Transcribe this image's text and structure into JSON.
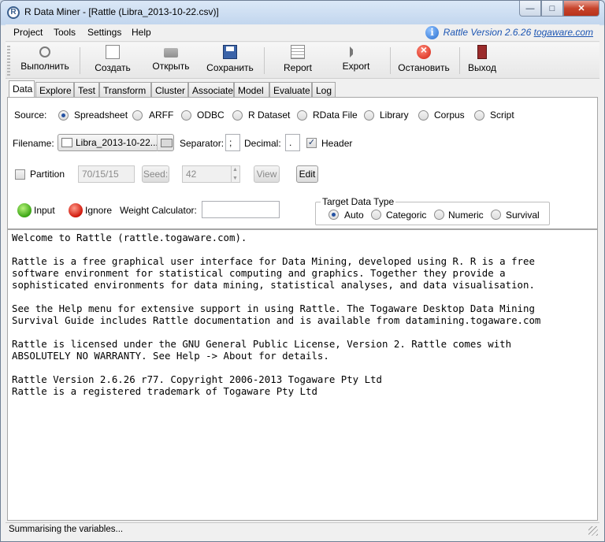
{
  "window": {
    "title": "R Data Miner - [Rattle (Libra_2013-10-22.csv)]",
    "app_icon_glyph": "R",
    "min_glyph": "—",
    "max_glyph": "□",
    "close_glyph": "✕"
  },
  "menubar": {
    "items": [
      "Project",
      "Tools",
      "Settings",
      "Help"
    ],
    "version_prefix": "Rattle Version 2.6.26 ",
    "version_link": "togaware.com",
    "info_glyph": "i"
  },
  "toolbar": {
    "buttons": [
      {
        "label": "Выполнить",
        "icon": "gear-icon"
      },
      {
        "label": "Создать",
        "icon": "new-document-icon"
      },
      {
        "label": "Открыть",
        "icon": "open-folder-icon"
      },
      {
        "label": "Сохранить",
        "icon": "save-icon"
      },
      {
        "label": "Report",
        "icon": "report-icon"
      },
      {
        "label": "Export",
        "icon": "export-icon"
      },
      {
        "label": "Остановить",
        "icon": "stop-icon"
      },
      {
        "label": "Выход",
        "icon": "exit-icon"
      }
    ]
  },
  "tabs": [
    "Data",
    "Explore",
    "Test",
    "Transform",
    "Cluster",
    "Associate",
    "Model",
    "Evaluate",
    "Log"
  ],
  "data_tab": {
    "source_label": "Source:",
    "sources": [
      {
        "label": "Spreadsheet",
        "selected": true
      },
      {
        "label": "ARFF",
        "selected": false
      },
      {
        "label": "ODBC",
        "selected": false
      },
      {
        "label": "R Dataset",
        "selected": false
      },
      {
        "label": "RData File",
        "selected": false
      },
      {
        "label": "Library",
        "selected": false
      },
      {
        "label": "Corpus",
        "selected": false
      },
      {
        "label": "Script",
        "selected": false
      }
    ],
    "filename_label": "Filename:",
    "filename_value": "Libra_2013-10-22...",
    "separator_label": "Separator:",
    "separator_value": ";",
    "decimal_label": "Decimal:",
    "decimal_value": ".",
    "header_label": "Header",
    "header_checked": true,
    "check_glyph": "✓",
    "partition_label": "Partition",
    "partition_checked": false,
    "partition_value": "70/15/15",
    "seed_label": "Seed:",
    "seed_value": "42",
    "view_label": "View",
    "edit_label": "Edit",
    "input_label": "Input",
    "ignore_label": "Ignore",
    "weight_label": "Weight Calculator:",
    "weight_value": "",
    "target_type_title": "Target Data Type",
    "target_types": [
      {
        "label": "Auto",
        "selected": true
      },
      {
        "label": "Categoric",
        "selected": false
      },
      {
        "label": "Numeric",
        "selected": false
      },
      {
        "label": "Survival",
        "selected": false
      }
    ]
  },
  "textview": {
    "lines": [
      "Welcome to Rattle (rattle.togaware.com).",
      "",
      "Rattle is a free graphical user interface for Data Mining, developed using R. R is a free",
      "software environment for statistical computing and graphics. Together they provide a",
      "sophisticated environments for data mining, statistical analyses, and data visualisation.",
      "",
      "See the Help menu for extensive support in using Rattle. The Togaware Desktop Data Mining",
      "Survival Guide includes Rattle documentation and is available from datamining.togaware.com",
      "",
      "Rattle is licensed under the GNU General Public License, Version 2. Rattle comes with",
      "ABSOLUTELY NO WARRANTY. See Help -> About for details.",
      "",
      "Rattle Version 2.6.26 r77. Copyright 2006-2013 Togaware Pty Ltd",
      "Rattle is a registered trademark of Togaware Pty Ltd"
    ]
  },
  "status": {
    "text": "Summarising the variables..."
  }
}
